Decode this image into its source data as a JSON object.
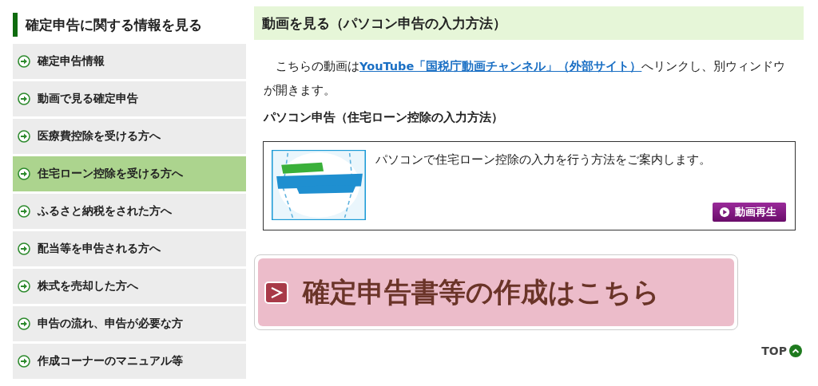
{
  "sidebar": {
    "title": "確定申告に関する情報を見る",
    "items": [
      {
        "label": "確定申告情報",
        "selected": false
      },
      {
        "label": "動画で見る確定申告",
        "selected": false
      },
      {
        "label": "医療費控除を受ける方へ",
        "selected": false
      },
      {
        "label": "住宅ローン控除を受ける方へ",
        "selected": true
      },
      {
        "label": "ふるさと納税をされた方へ",
        "selected": false
      },
      {
        "label": "配当等を申告される方へ",
        "selected": false
      },
      {
        "label": "株式を売却した方へ",
        "selected": false
      },
      {
        "label": "申告の流れ、申告が必要な方",
        "selected": false
      },
      {
        "label": "作成コーナーのマニュアル等",
        "selected": false
      }
    ]
  },
  "main": {
    "heading": "動画を見る（パソコン申告の入力方法）",
    "intro": {
      "before": "　こちらの動画は",
      "link": "YouTube「国税庁動画チャンネル」（外部サイト）",
      "after": "へリンクし、別ウィンドウが開きます。"
    },
    "subheading": "パソコン申告（住宅ローン控除の入力方法）",
    "video": {
      "description": "パソコンで住宅ローン控除の入力を行う方法をご案内します。",
      "play_button": "動画再生"
    },
    "cta_button": "確定申告書等の作成はこちら",
    "top_link": "TOP"
  }
}
